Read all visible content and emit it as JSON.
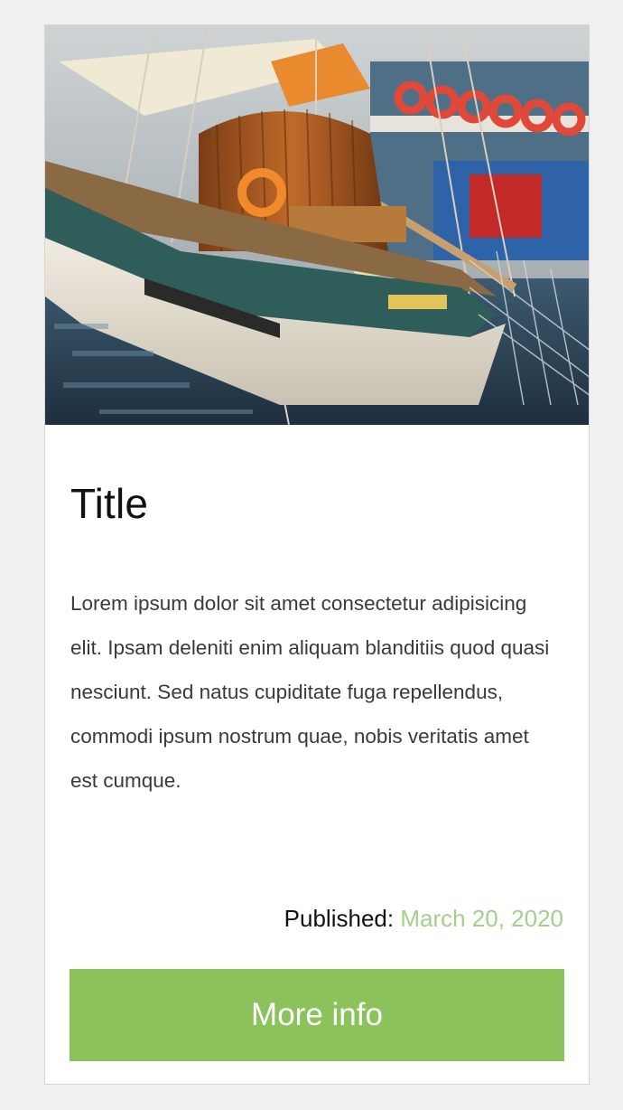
{
  "card": {
    "image_alt": "Sailboat docked in a harbor",
    "title": "Title",
    "body": "Lorem ipsum dolor sit amet consectetur adipisicing elit. Ipsam deleniti enim aliquam blanditiis quod quasi nesciunt. Sed natus cupiditate fuga repellendus, commodi ipsum nostrum quae, nobis veritatis amet est cumque.",
    "published_label": "Published:",
    "published_date": "March 20, 2020",
    "button_label": "More info"
  },
  "colors": {
    "page_background": "#f0f0f0",
    "card_background": "#ffffff",
    "accent_green": "#8bc25b",
    "date_green": "#a3d08a"
  }
}
